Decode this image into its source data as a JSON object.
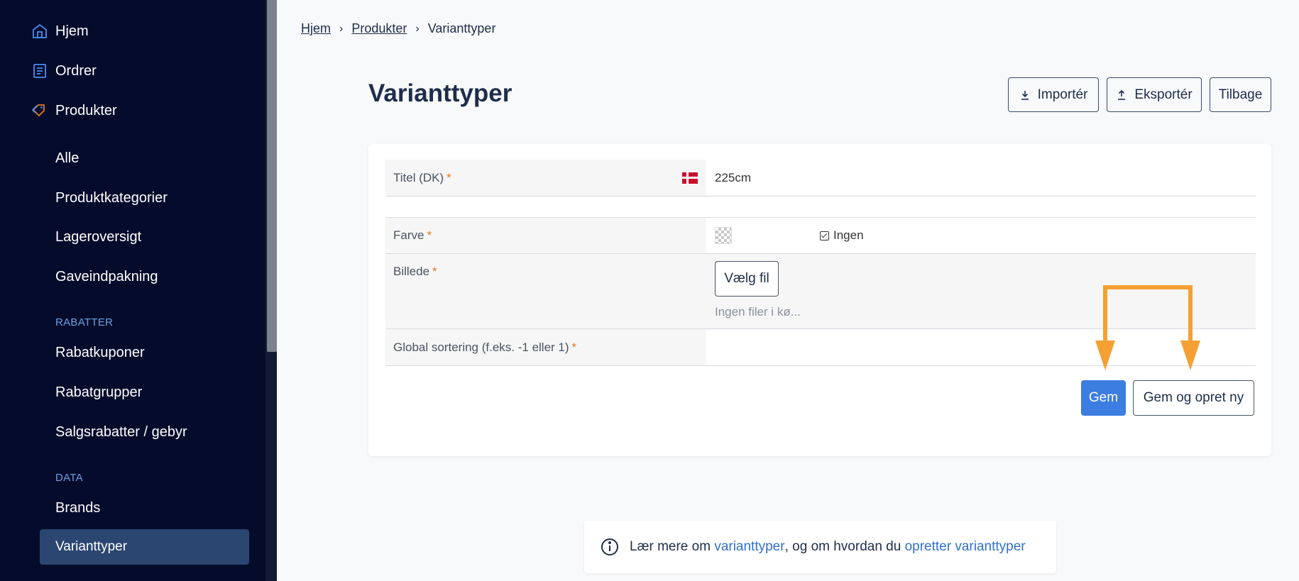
{
  "sidebar": {
    "top_items": [
      {
        "label": "Hjem",
        "icon": "home-icon"
      },
      {
        "label": "Ordrer",
        "icon": "list-icon"
      },
      {
        "label": "Produkter",
        "icon": "tag-icon"
      }
    ],
    "product_items": [
      "Alle",
      "Produktkategorier",
      "Lageroversigt",
      "Gaveindpakning"
    ],
    "section_rabatter": "RABATTER",
    "rabatter_items": [
      "Rabatkuponer",
      "Rabatgrupper",
      "Salgsrabatter / gebyr"
    ],
    "section_data": "DATA",
    "data_items": [
      "Brands",
      "Varianttyper"
    ],
    "colors": {
      "background": "#050c2b",
      "active": "#2b4670",
      "section": "#6ea0e8"
    }
  },
  "breadcrumb": {
    "items": [
      "Hjem",
      "Produkter",
      "Varianttyper"
    ],
    "separator": "›"
  },
  "page": {
    "title": "Varianttyper",
    "buttons": {
      "import": "Importér",
      "export": "Eksportér",
      "back": "Tilbage"
    }
  },
  "form": {
    "title_label": "Titel (DK)",
    "title_value": "225cm",
    "color_label": "Farve",
    "color_none_label": "Ingen",
    "image_label": "Billede",
    "choose_file": "Vælg fil",
    "no_files": "Ingen filer i kø...",
    "sort_label": "Global sortering (f.eks. -1 eller 1)",
    "required_mark": "*",
    "save": "Gem",
    "save_new": "Gem og opret ny",
    "colors": {
      "primary": "#3b7de0",
      "required": "#e8791d",
      "arrow": "#f5a032"
    }
  },
  "info": {
    "text_1": "Lær mere om ",
    "link_1": "varianttyper",
    "text_2": ", og om hvordan du ",
    "link_2": "opretter varianttyper"
  }
}
